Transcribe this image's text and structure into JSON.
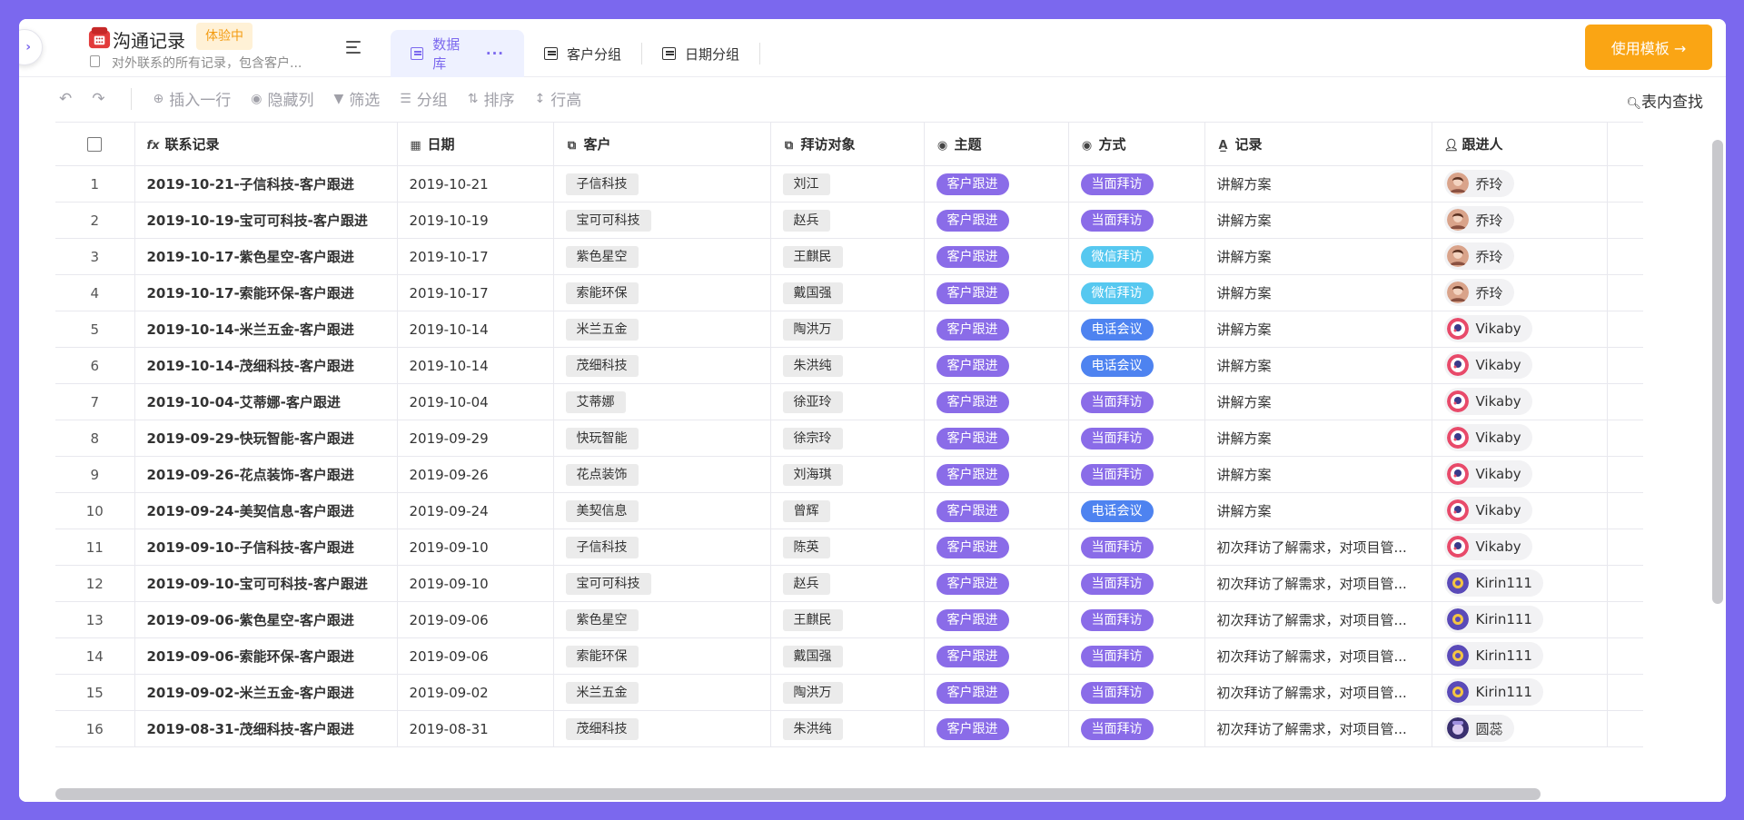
{
  "header": {
    "title": "沟通记录",
    "trial_badge": "体验中",
    "description": "对外联系的所有记录，包含客户...",
    "tabs": [
      {
        "label": "数据库",
        "more": "···"
      },
      {
        "label": "客户分组"
      },
      {
        "label": "日期分组"
      }
    ],
    "use_template": "使用模板 →"
  },
  "toolbar": {
    "undo": "↶",
    "redo": "↷",
    "insert_row": "插入一行",
    "hide_cols": "隐藏列",
    "filter": "筛选",
    "group": "分组",
    "sort": "排序",
    "row_height": "行高",
    "search": "表内查找"
  },
  "columns": [
    "联系记录",
    "日期",
    "客户",
    "拜访对象",
    "主题",
    "方式",
    "记录",
    "跟进人"
  ],
  "colors": {
    "purple": "#7B68EE",
    "topic": "#8A6CE8",
    "visit": "#8A6CE8",
    "wechat": "#56C8F0",
    "phone": "#4E83F0",
    "accent": "#FAA514"
  },
  "rows": [
    {
      "n": "1",
      "title": "2019-10-21-子信科技-客户跟进",
      "date": "2019-10-21",
      "client": "子信科技",
      "contact": "刘江",
      "topic": "客户跟进",
      "method": "当面拜访",
      "mtype": "visit",
      "record": "讲解方案",
      "person": "乔玲",
      "ptype": "qiao"
    },
    {
      "n": "2",
      "title": "2019-10-19-宝可可科技-客户跟进",
      "date": "2019-10-19",
      "client": "宝可可科技",
      "contact": "赵兵",
      "topic": "客户跟进",
      "method": "当面拜访",
      "mtype": "visit",
      "record": "讲解方案",
      "person": "乔玲",
      "ptype": "qiao"
    },
    {
      "n": "3",
      "title": "2019-10-17-紫色星空-客户跟进",
      "date": "2019-10-17",
      "client": "紫色星空",
      "contact": "王麒民",
      "topic": "客户跟进",
      "method": "微信拜访",
      "mtype": "wechat",
      "record": "讲解方案",
      "person": "乔玲",
      "ptype": "qiao"
    },
    {
      "n": "4",
      "title": "2019-10-17-索能环保-客户跟进",
      "date": "2019-10-17",
      "client": "索能环保",
      "contact": "戴国强",
      "topic": "客户跟进",
      "method": "微信拜访",
      "mtype": "wechat",
      "record": "讲解方案",
      "person": "乔玲",
      "ptype": "qiao"
    },
    {
      "n": "5",
      "title": "2019-10-14-米兰五金-客户跟进",
      "date": "2019-10-14",
      "client": "米兰五金",
      "contact": "陶洪万",
      "topic": "客户跟进",
      "method": "电话会议",
      "mtype": "phone",
      "record": "讲解方案",
      "person": "Vikaby",
      "ptype": "vik"
    },
    {
      "n": "6",
      "title": "2019-10-14-茂细科技-客户跟进",
      "date": "2019-10-14",
      "client": "茂细科技",
      "contact": "朱洪纯",
      "topic": "客户跟进",
      "method": "电话会议",
      "mtype": "phone",
      "record": "讲解方案",
      "person": "Vikaby",
      "ptype": "vik"
    },
    {
      "n": "7",
      "title": "2019-10-04-艾蒂娜-客户跟进",
      "date": "2019-10-04",
      "client": "艾蒂娜",
      "contact": "徐亚玲",
      "topic": "客户跟进",
      "method": "当面拜访",
      "mtype": "visit",
      "record": "讲解方案",
      "person": "Vikaby",
      "ptype": "vik"
    },
    {
      "n": "8",
      "title": "2019-09-29-快玩智能-客户跟进",
      "date": "2019-09-29",
      "client": "快玩智能",
      "contact": "徐宗玲",
      "topic": "客户跟进",
      "method": "当面拜访",
      "mtype": "visit",
      "record": "讲解方案",
      "person": "Vikaby",
      "ptype": "vik"
    },
    {
      "n": "9",
      "title": "2019-09-26-花点装饰-客户跟进",
      "date": "2019-09-26",
      "client": "花点装饰",
      "contact": "刘海琪",
      "topic": "客户跟进",
      "method": "当面拜访",
      "mtype": "visit",
      "record": "讲解方案",
      "person": "Vikaby",
      "ptype": "vik"
    },
    {
      "n": "10",
      "title": "2019-09-24-美契信息-客户跟进",
      "date": "2019-09-24",
      "client": "美契信息",
      "contact": "曾辉",
      "topic": "客户跟进",
      "method": "电话会议",
      "mtype": "phone",
      "record": "讲解方案",
      "person": "Vikaby",
      "ptype": "vik"
    },
    {
      "n": "11",
      "title": "2019-09-10-子信科技-客户跟进",
      "date": "2019-09-10",
      "client": "子信科技",
      "contact": "陈英",
      "topic": "客户跟进",
      "method": "当面拜访",
      "mtype": "visit",
      "record": "初次拜访了解需求，对项目管...",
      "person": "Vikaby",
      "ptype": "vik"
    },
    {
      "n": "12",
      "title": "2019-09-10-宝可可科技-客户跟进",
      "date": "2019-09-10",
      "client": "宝可可科技",
      "contact": "赵兵",
      "topic": "客户跟进",
      "method": "当面拜访",
      "mtype": "visit",
      "record": "初次拜访了解需求，对项目管...",
      "person": "Kirin111",
      "ptype": "kir"
    },
    {
      "n": "13",
      "title": "2019-09-06-紫色星空-客户跟进",
      "date": "2019-09-06",
      "client": "紫色星空",
      "contact": "王麒民",
      "topic": "客户跟进",
      "method": "当面拜访",
      "mtype": "visit",
      "record": "初次拜访了解需求，对项目管...",
      "person": "Kirin111",
      "ptype": "kir"
    },
    {
      "n": "14",
      "title": "2019-09-06-索能环保-客户跟进",
      "date": "2019-09-06",
      "client": "索能环保",
      "contact": "戴国强",
      "topic": "客户跟进",
      "method": "当面拜访",
      "mtype": "visit",
      "record": "初次拜访了解需求，对项目管...",
      "person": "Kirin111",
      "ptype": "kir"
    },
    {
      "n": "15",
      "title": "2019-09-02-米兰五金-客户跟进",
      "date": "2019-09-02",
      "client": "米兰五金",
      "contact": "陶洪万",
      "topic": "客户跟进",
      "method": "当面拜访",
      "mtype": "visit",
      "record": "初次拜访了解需求，对项目管...",
      "person": "Kirin111",
      "ptype": "kir"
    },
    {
      "n": "16",
      "title": "2019-08-31-茂细科技-客户跟进",
      "date": "2019-08-31",
      "client": "茂细科技",
      "contact": "朱洪纯",
      "topic": "客户跟进",
      "method": "当面拜访",
      "mtype": "visit",
      "record": "初次拜访了解需求，对项目管...",
      "person": "圆蕊",
      "ptype": "yuan"
    }
  ]
}
